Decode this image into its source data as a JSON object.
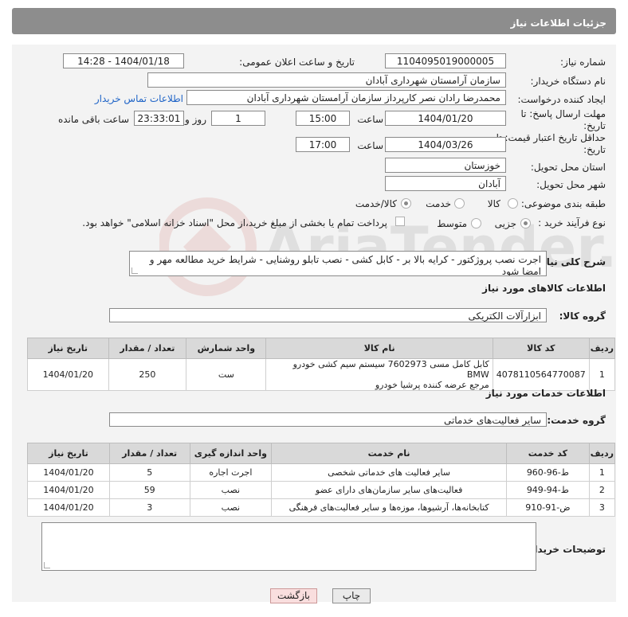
{
  "header": {
    "title": "جزئیات اطلاعات نیاز"
  },
  "form": {
    "need_number_label": "شماره نیاز:",
    "need_number": "1104095019000005",
    "announce_label": "تاریخ و ساعت اعلان عمومی:",
    "announce_value": "1404/01/18 - 14:28",
    "buyer_org_label": "نام دستگاه خریدار:",
    "buyer_org": "سازمان آرامستان شهرداری آبادان",
    "creator_label": "ایجاد کننده درخواست:",
    "creator": "محمدرضا رادان نصر کارپرداز سازمان آرامستان شهرداری آبادان",
    "contact_link": "اطلاعات تماس خریدار",
    "deadline_label": "مهلت ارسال پاسخ: تا تاریخ:",
    "deadline_date": "1404/01/20",
    "time_label": "ساعت",
    "deadline_time": "15:00",
    "days_value": "1",
    "days_label": "روز و",
    "remaining_time": "23:33:01",
    "remaining_label": "ساعت باقی مانده",
    "validity_label": "حداقل تاریخ اعتبار قیمت: تا تاریخ:",
    "validity_date": "1404/03/26",
    "validity_time": "17:00",
    "province_label": "استان محل تحویل:",
    "province": "خوزستان",
    "city_label": "شهر محل تحویل:",
    "city": "آبادان",
    "category_label": "طبقه بندی موضوعی:",
    "category_options": [
      "کالا",
      "خدمت",
      "کالا/خدمت"
    ],
    "process_label": "نوع فرآیند خرید :",
    "process_options": [
      "جزیی",
      "متوسط"
    ],
    "payment_note": "پرداخت تمام یا بخشی از مبلغ خرید،از محل \"اسناد خزانه اسلامی\" خواهد بود.",
    "description_label": "شرح کلی نیاز:",
    "description": "اجرت نصب پروژکتور - کرایه بالا بر - کابل کشی - نصب تابلو روشنایی - شرایط خرید مطالعه مهر و امضا شود"
  },
  "goods": {
    "section_title": "اطلاعات کالاهای مورد نیاز",
    "group_label": "گروه کالا:",
    "group_value": "ابزارآلات الکتریکی",
    "columns": [
      "ردیف",
      "کد کالا",
      "نام کالا",
      "واحد شمارش",
      "تعداد / مقدار",
      "تاریخ نیاز"
    ],
    "rows": [
      {
        "row": "1",
        "code": "4078110564770087",
        "name_line1": "کابل کامل مسی 7602973 سیستم سیم کشی خودرو BMW",
        "name_line2": "مرجع عرضه کننده پرشیا خودرو",
        "unit": "ست",
        "qty": "250",
        "date": "1404/01/20"
      }
    ]
  },
  "services": {
    "section_title": "اطلاعات خدمات مورد نیاز",
    "group_label": "گروه خدمت:",
    "group_value": "سایر فعالیت‌های خدماتی",
    "columns": [
      "ردیف",
      "کد خدمت",
      "نام خدمت",
      "واحد اندازه گیری",
      "تعداد / مقدار",
      "تاریخ نیاز"
    ],
    "rows": [
      {
        "row": "1",
        "code": "ط-96-960",
        "name": "سایر فعالیت های خدماتی شخصی",
        "unit": "اجرت اجاره",
        "qty": "5",
        "date": "1404/01/20"
      },
      {
        "row": "2",
        "code": "ط-94-949",
        "name": "فعالیت‌های سایر سازمان‌های دارای عضو",
        "unit": "نصب",
        "qty": "59",
        "date": "1404/01/20"
      },
      {
        "row": "3",
        "code": "ض-91-910",
        "name": "کتابخانه‌ها، آرشیوها، موزه‌ها و سایر فعالیت‌های فرهنگی",
        "unit": "نصب",
        "qty": "3",
        "date": "1404/01/20"
      }
    ]
  },
  "buyer_notes": {
    "label": "توضیحات خریدار:",
    "value": ""
  },
  "buttons": {
    "print": "چاپ",
    "back": "بازگشت"
  },
  "watermark": {
    "text": "AriaTender.neT"
  }
}
